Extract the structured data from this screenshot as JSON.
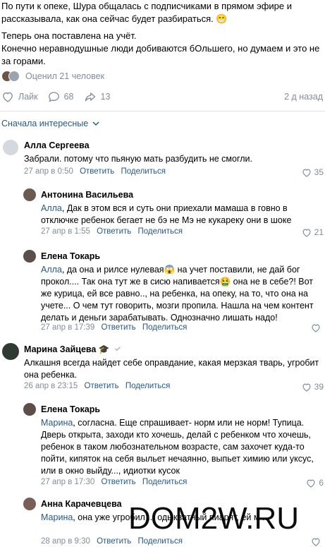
{
  "post": {
    "line1": "По пути к опеке, Шура общалась с подписчиками в прямом эфире и рассказывала, как она сейчас будет разбираться. 😁",
    "line2": "Теперь она поставлена на учёт.",
    "line3": "Конечно неравнодушные люди добиваются бОльшего, но думаем и это не за горами.",
    "views": "Оценил 21 человек",
    "like_label": "Лайк",
    "comments_count": "68",
    "reposts_count": "13",
    "time": "2 д назад"
  },
  "sort_label": "Сначала интересные",
  "comments": [
    {
      "name": "Алла Сергеева",
      "reply_to": "",
      "text": "Забрали. потому что пьяную мать разбудить не смогли.",
      "date": "27 апр в 0:50",
      "reply": "Ответить",
      "share": "Поделиться",
      "likes": "35"
    },
    {
      "name": "Антонина Васильева",
      "reply_to": "Алла",
      "text": ", Дак в этом вся и суть они приехали мамаша в говно в отключке ребенок бегает не бэ не Мэ не кукареку они в шоке",
      "date": "27 апр в 1:55",
      "reply": "Ответить",
      "share": "Поделиться",
      "likes": "21"
    },
    {
      "name": "Елена Токарь",
      "reply_to": "Алла",
      "text": ", да она и рилсе нулевая😱 на учет поставили, не дай бог прокол.... Так она тут же в сисю напивается🤮 она не в себе?! Вот же курица, ей все равно.., на ребенка, на опеку, на то, что она на учете... О чем тут говорить, мозги пропила. Нашла на чем контент делать и деньги зарабатывать. Однозначно лишать надо!",
      "date": "27 апр в 17:39",
      "reply": "Ответить",
      "share": "Поделиться",
      "likes": ""
    },
    {
      "name": "Марина Зайцева",
      "reply_to": "",
      "text": "Алкашня всегда найдет себе оправдание, какая мерзкая тварь, угробит она ребенка.",
      "date": "26 апр в 23:15",
      "reply": "Ответить",
      "share": "Поделиться",
      "likes": "39"
    },
    {
      "name": "Елена Токарь",
      "reply_to": "Марина",
      "text": ", согласна. Еще спрашивает- норм или не норм! Тупица. Дверь открыта, заходи кто хочешь, делай с ребенком что хочешь, ребенок в таком любознательном возрасте, сам захочет куда-то пойти, кипяток на себя выльет нечаянно, выпьет химию или уксус, или в окно выйду..., идиотки кусок",
      "date": "27 апр в 17:30",
      "reply": "Ответить",
      "share": "Поделиться",
      "likes": "6"
    },
    {
      "name": "Анна Карачевцева",
      "reply_to": "Марина",
      "text": ", она уже угробил ... одыкватный пиарят, ей м ...",
      "date": "28 апр в 9:30",
      "reply": "Ответить",
      "share": "Поделиться",
      "likes": ""
    }
  ],
  "watermark": "DOM2W.RU",
  "colors": {
    "link": "#2a5885",
    "muted": "#818c99",
    "divider": "#e1e3e6",
    "verified": "#aeb7c2"
  }
}
